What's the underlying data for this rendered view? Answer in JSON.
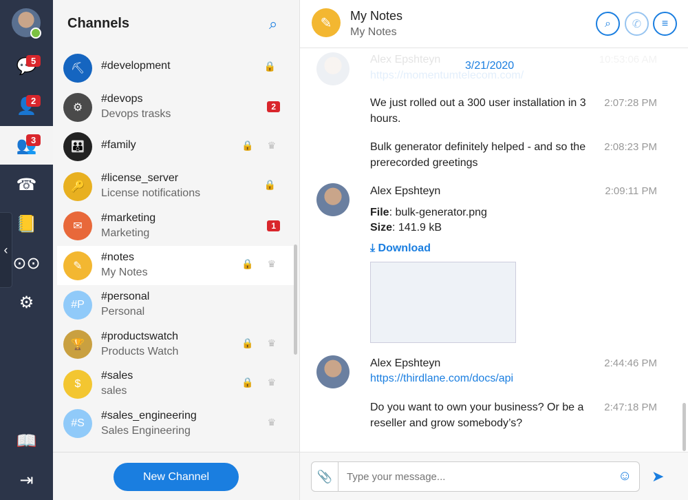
{
  "nav": {
    "badges": {
      "chats": "5",
      "contacts": "2",
      "channels": "3"
    }
  },
  "channels": {
    "title": "Channels",
    "new_channel": "New Channel",
    "items": [
      {
        "name": "#development",
        "sub": "",
        "badge": "",
        "icons": "🔒",
        "color": "#1565c0",
        "ini": "⛏"
      },
      {
        "name": "#devops",
        "sub": "Devops trasks",
        "badge": "2",
        "icons": "",
        "color": "#4a4a4a",
        "ini": "⚙"
      },
      {
        "name": "#family",
        "sub": "",
        "badge": "",
        "icons": "🔒 ♛",
        "color": "#222",
        "ini": "👪"
      },
      {
        "name": "#license_server",
        "sub": "License notifications",
        "badge": "",
        "icons": "🔒",
        "color": "#e8b020",
        "ini": "🔑"
      },
      {
        "name": "#marketing",
        "sub": "Marketing",
        "badge": "1",
        "icons": "",
        "color": "#e8683a",
        "ini": "✉"
      },
      {
        "name": "#notes",
        "sub": "My Notes",
        "badge": "",
        "icons": "🔒 ♛",
        "color": "#f3b731",
        "ini": "✎"
      },
      {
        "name": "#personal",
        "sub": "Personal",
        "badge": "",
        "icons": "",
        "color": "#90caf9",
        "ini": "#P"
      },
      {
        "name": "#productswatch",
        "sub": "Products Watch",
        "badge": "",
        "icons": "🔒 ♛",
        "color": "#c9a040",
        "ini": "🏆"
      },
      {
        "name": "#sales",
        "sub": "sales",
        "badge": "",
        "icons": "🔒 ♛",
        "color": "#f3c631",
        "ini": "$"
      },
      {
        "name": "#sales_engineering",
        "sub": "Sales Engineering",
        "badge": "",
        "icons": "♛",
        "color": "#90caf9",
        "ini": "#S"
      }
    ]
  },
  "chat": {
    "title": "My Notes",
    "subtitle": "My Notes",
    "date": "3/21/2020",
    "placeholder": "Type your message...",
    "faded": {
      "author": "Alex Epshteyn",
      "time": "10:53:06 AM",
      "link": "https://momentumtelecom.com/"
    },
    "m1": {
      "text": "We just rolled out a 300 user installation in 3 hours.",
      "time": "2:07:28 PM"
    },
    "m2": {
      "text": "Bulk generator definitely helped - and so the prerecorded greetings",
      "time": "2:08:23 PM"
    },
    "m3": {
      "author": "Alex Epshteyn",
      "time": "2:09:11 PM",
      "file_label": "File",
      "file": ": bulk-generator.png",
      "size_label": "Size",
      "size": ": 141.9 kB",
      "download": "Download"
    },
    "m4": {
      "author": "Alex Epshteyn",
      "time": "2:44:46 PM",
      "link": "https://thirdlane.com/docs/api"
    },
    "m5": {
      "text": "Do you want to own your business? Or be a reseller and grow somebody’s?",
      "time": "2:47:18 PM"
    }
  }
}
